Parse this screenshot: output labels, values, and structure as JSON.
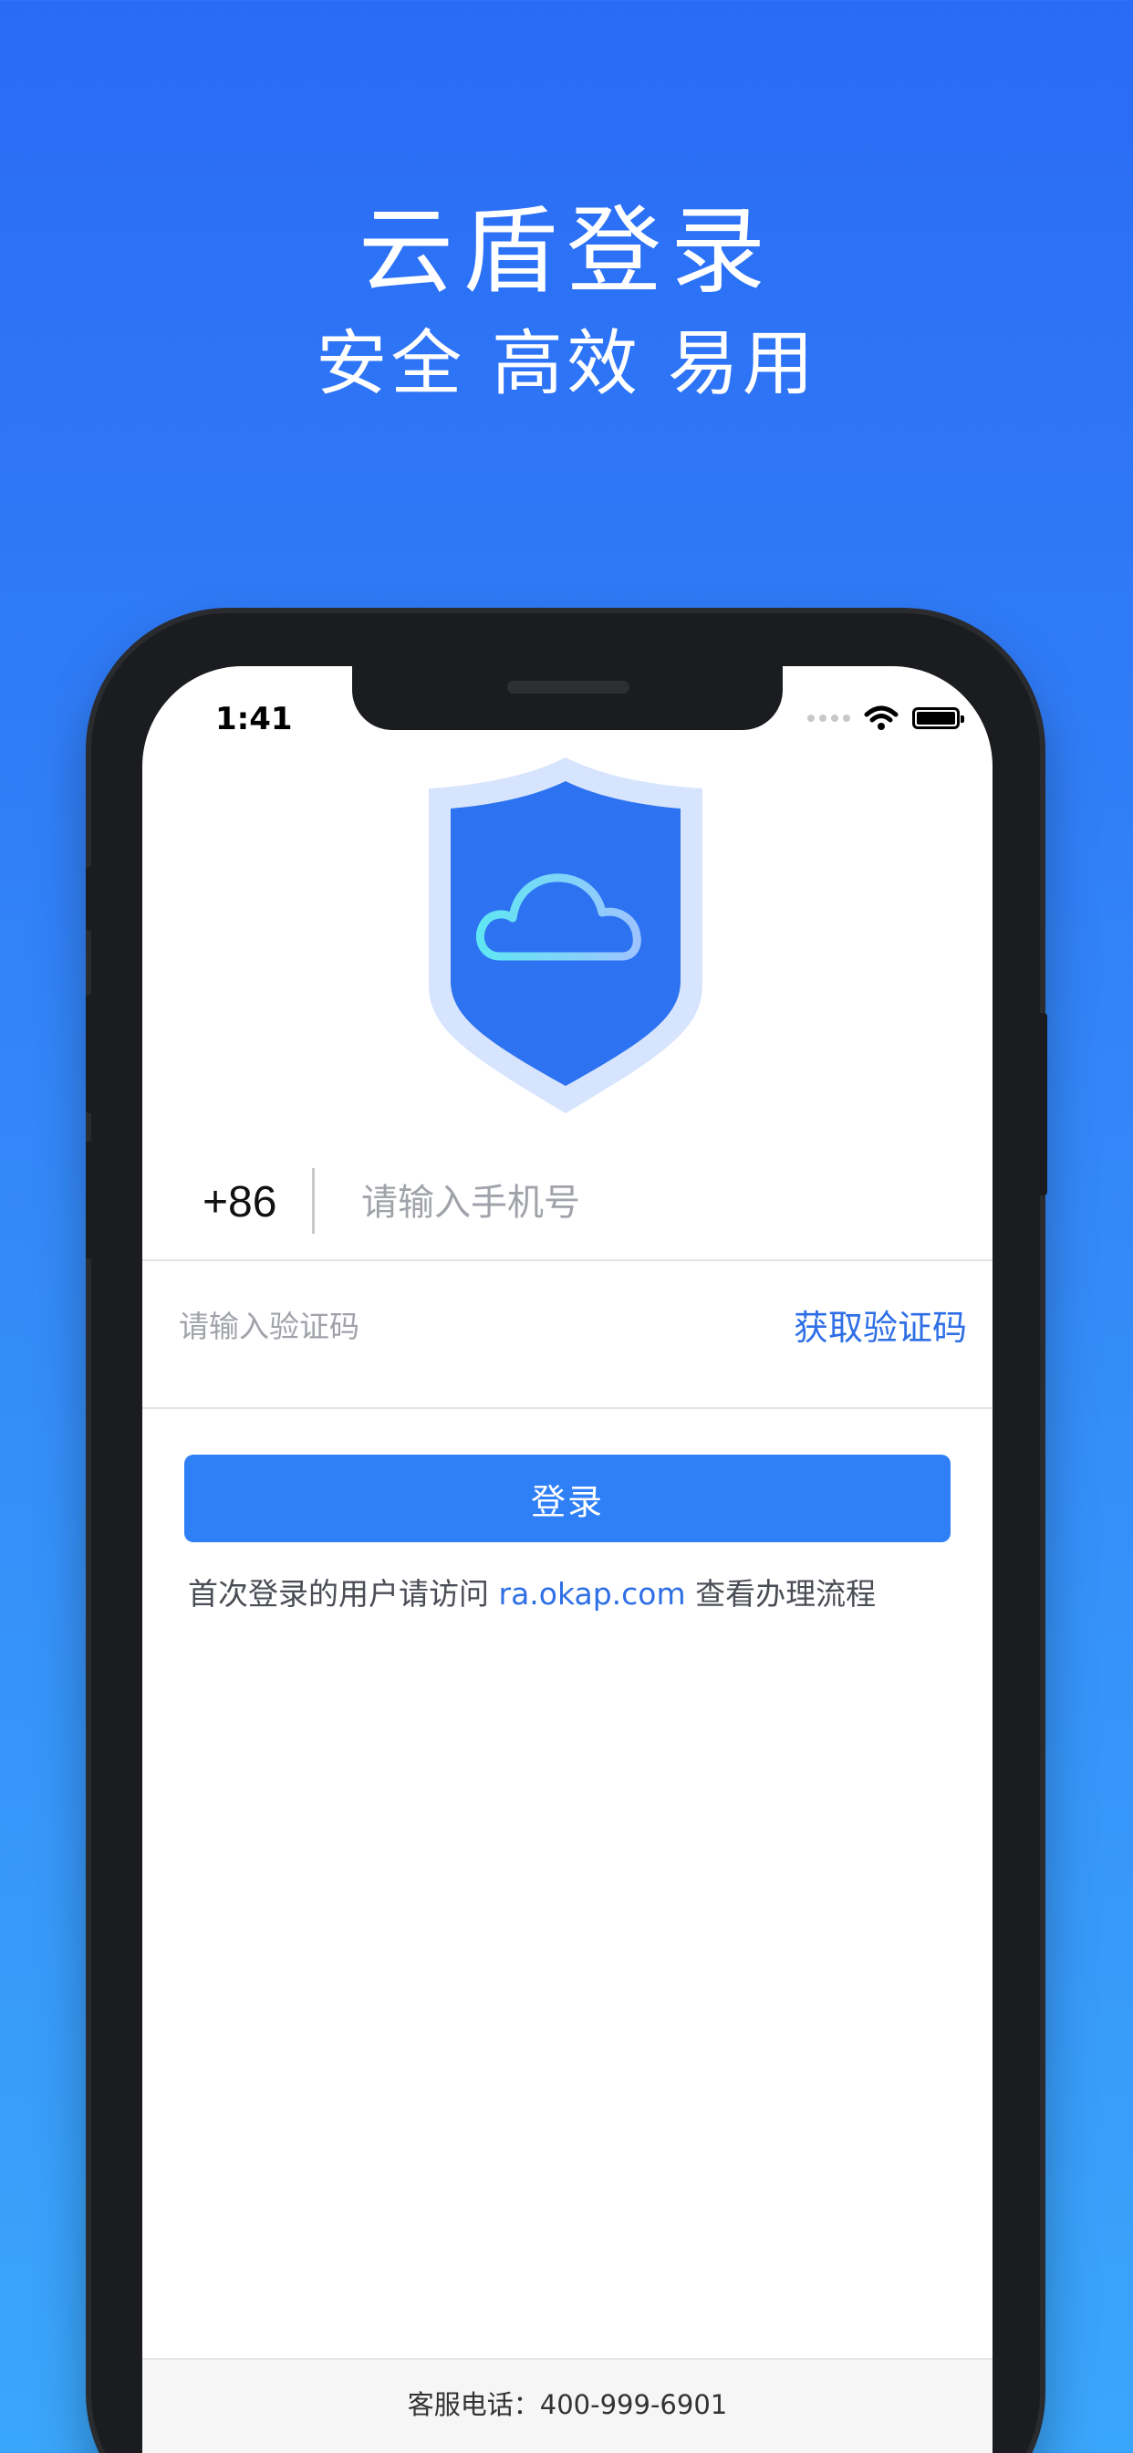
{
  "hero": {
    "title": "云盾登录",
    "subtitle": "安全 高效 易用"
  },
  "status_bar": {
    "time": "1:41"
  },
  "login_form": {
    "country_code": "+86",
    "phone_placeholder": "请输入手机号",
    "code_placeholder": "请输入验证码",
    "get_code_label": "获取验证码",
    "login_label": "登录",
    "hint_prefix": "首次登录的用户请访问 ",
    "hint_link": "ra.okap.com",
    "hint_suffix": " 查看办理流程"
  },
  "footer": {
    "support_phone": "客服电话：400-999-6901"
  },
  "icons": {
    "logo": "shield-cloud-icon",
    "wifi": "wifi-icon",
    "battery": "battery-icon",
    "signal": "signal-dots-icon"
  },
  "colors": {
    "brand_blue": "#2f7ff6",
    "link_blue": "#2f6fe6",
    "background_top": "#2a6bf5",
    "background_bottom": "#3aa6fb"
  }
}
